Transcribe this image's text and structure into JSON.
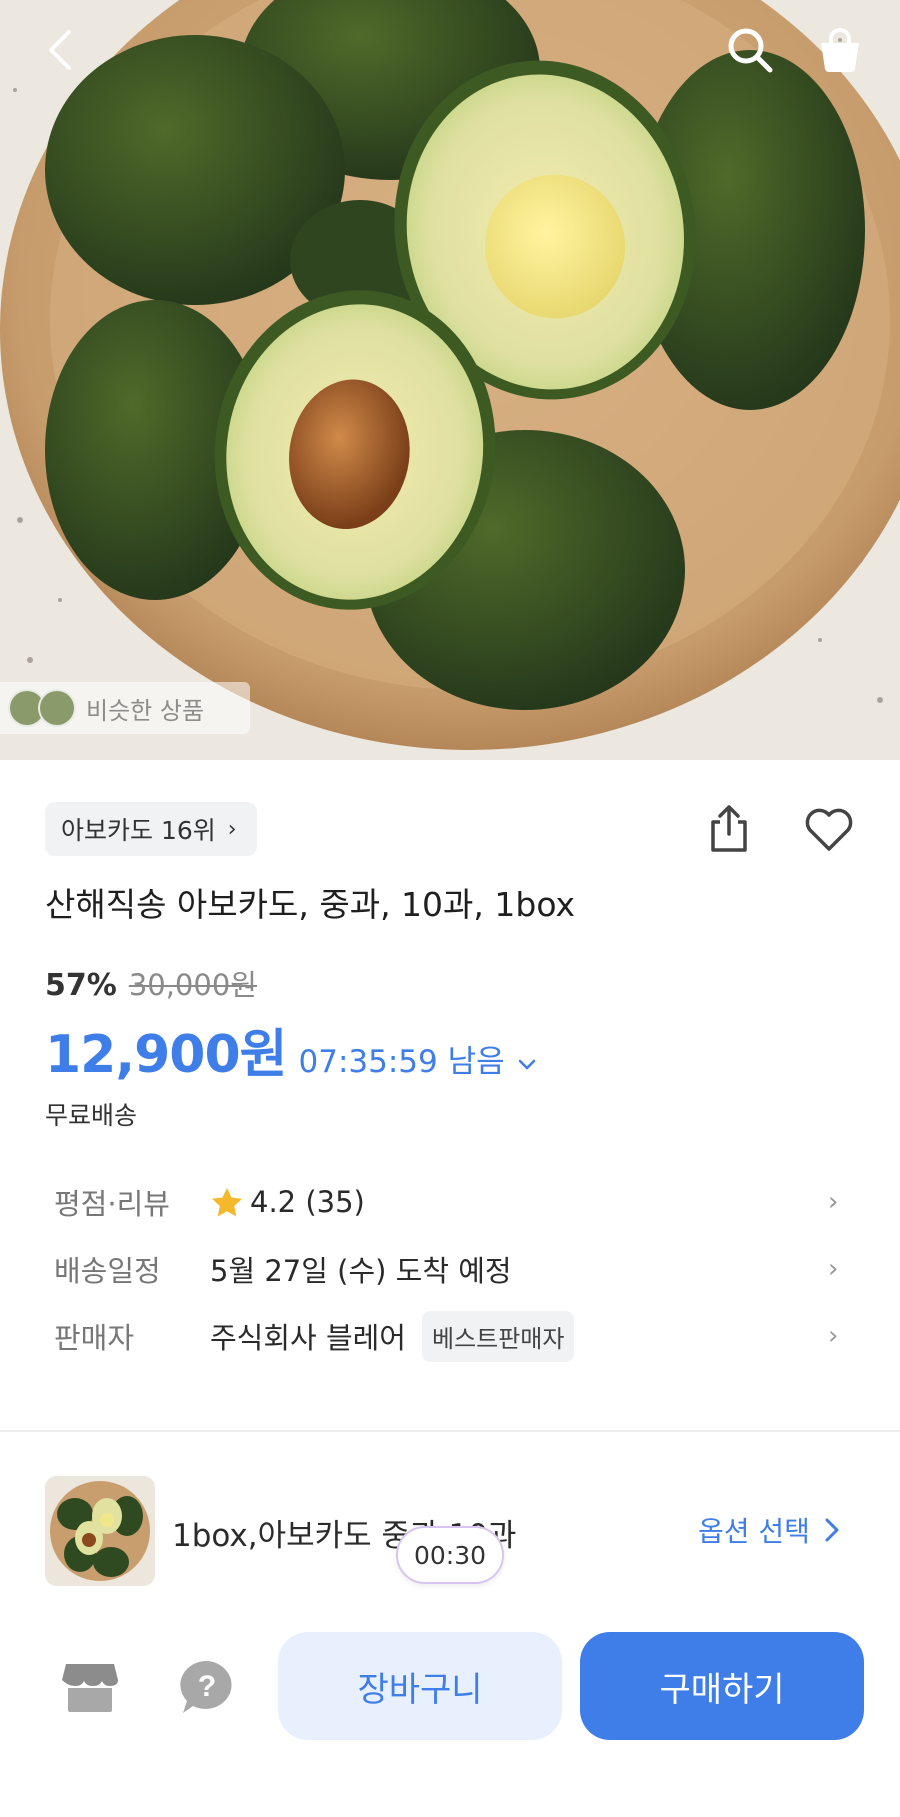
{
  "header": {
    "back_icon": "chevron-left-icon",
    "search_icon": "search-icon",
    "bag_icon": "shopping-bag-icon"
  },
  "hero": {
    "similar_label": "비슷한 상품"
  },
  "product": {
    "rank_label": "아보카도 16위",
    "title": "산해직송 아보카도, 중과, 10과, 1box",
    "discount": "57%",
    "original_price": "30,000원",
    "price": "12,900원",
    "timer": "07:35:59 남음",
    "shipping": "무료배송"
  },
  "details": {
    "rating_key": "평점·리뷰",
    "rating_value": "4.2 (35)",
    "delivery_key": "배송일정",
    "delivery_value": "5월 27일 (수) 도착 예정",
    "seller_key": "판매자",
    "seller_value": "주식회사 블레어",
    "seller_badge": "베스트판매자"
  },
  "option": {
    "label": "1box,아보카도 중과 10과",
    "select_label": "옵션 선택",
    "overlay_timer": "00:30"
  },
  "bottom_bar": {
    "cart_label": "장바구니",
    "buy_label": "구매하기"
  },
  "colors": {
    "accent": "#3f7ee8",
    "accent_light": "#e8f0fd",
    "star": "#f5b72b"
  }
}
